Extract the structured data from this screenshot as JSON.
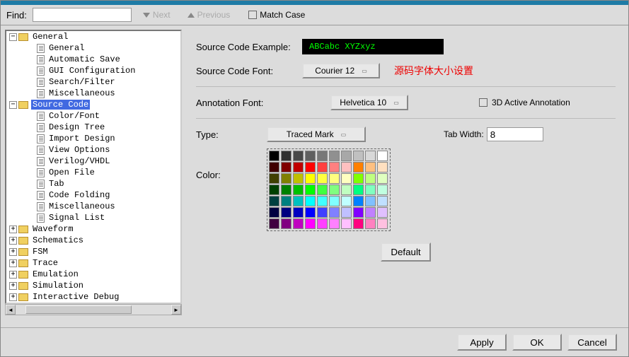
{
  "find": {
    "label": "Find:",
    "value": "",
    "next": "Next",
    "previous": "Previous",
    "match_case": "Match Case"
  },
  "tree": {
    "general": {
      "label": "General",
      "children": [
        "General",
        "Automatic Save",
        "GUI Configuration",
        "Search/Filter",
        "Miscellaneous"
      ]
    },
    "source_code": {
      "label": "Source Code",
      "children": [
        "Color/Font",
        "Design Tree",
        "Import Design",
        "View Options",
        "Verilog/VHDL",
        "Open File",
        "Tab",
        "Code Folding",
        "Miscellaneous",
        "Signal List"
      ]
    },
    "others": [
      "Waveform",
      "Schematics",
      "FSM",
      "Trace",
      "Emulation",
      "Simulation",
      "Interactive Debug"
    ]
  },
  "content": {
    "example_label": "Source Code Example:",
    "example_text": "ABCabc XYZxyz",
    "font_label": "Source Code Font:",
    "font_value": "Courier 12",
    "red_note": "源码字体大小设置",
    "annotation_label": "Annotation Font:",
    "annotation_value": "Helvetica 10",
    "active_annotation": "3D Active Annotation",
    "type_label": "Type:",
    "type_value": "Traced Mark",
    "tab_width_label": "Tab Width:",
    "tab_width_value": "8",
    "color_label": "Color:",
    "default_btn": "Default",
    "colors": [
      "#000000",
      "#303030",
      "#484848",
      "#606060",
      "#787878",
      "#909090",
      "#a8a8a8",
      "#c0c0c0",
      "#d8d8d8",
      "#ffffff",
      "#400000",
      "#800000",
      "#c00000",
      "#ff0000",
      "#ff4040",
      "#ff8080",
      "#ffc0c0",
      "#ff8000",
      "#ffc080",
      "#ffe0c0",
      "#404000",
      "#808000",
      "#c0c000",
      "#ffff00",
      "#ffff40",
      "#ffff80",
      "#ffffc0",
      "#80ff00",
      "#c0ff80",
      "#e0ffc0",
      "#004000",
      "#008000",
      "#00c000",
      "#00ff00",
      "#40ff40",
      "#80ff80",
      "#c0ffc0",
      "#00ff80",
      "#80ffc0",
      "#c0ffe0",
      "#004040",
      "#008080",
      "#00c0c0",
      "#00ffff",
      "#40ffff",
      "#80ffff",
      "#c0ffff",
      "#0080ff",
      "#80c0ff",
      "#c0e0ff",
      "#000040",
      "#000080",
      "#0000c0",
      "#0000ff",
      "#4040ff",
      "#8080ff",
      "#c0c0ff",
      "#8000ff",
      "#c080ff",
      "#e0c0ff",
      "#400040",
      "#800080",
      "#c000c0",
      "#ff00ff",
      "#ff40ff",
      "#ff80ff",
      "#ffc0ff",
      "#ff0080",
      "#ff80c0",
      "#ffc0e0"
    ]
  },
  "footer": {
    "apply": "Apply",
    "ok": "OK",
    "cancel": "Cancel"
  }
}
